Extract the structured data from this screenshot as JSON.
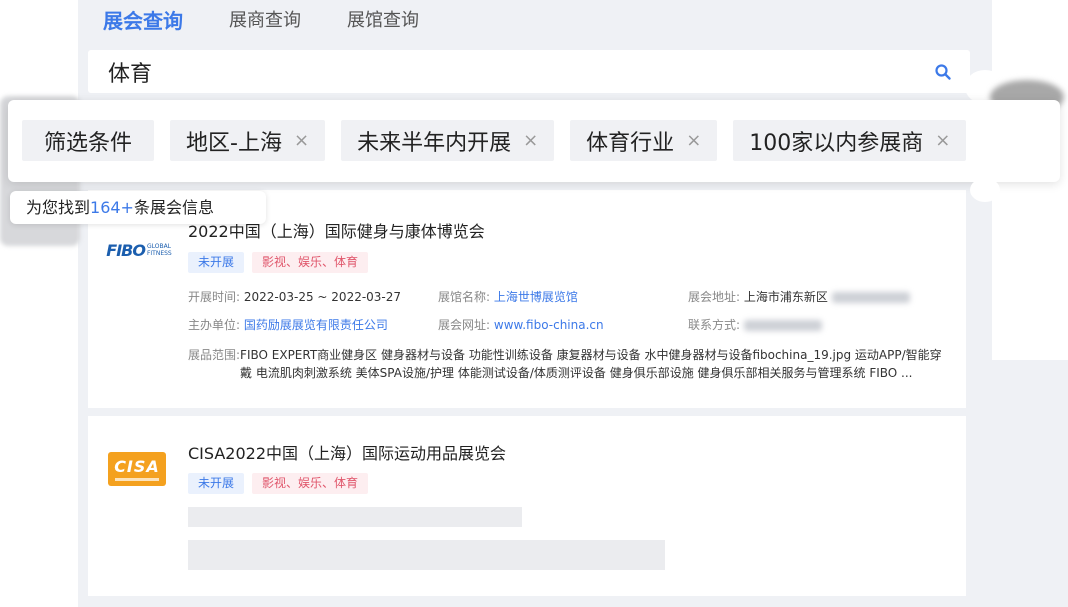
{
  "tabs": [
    {
      "label": "展会查询",
      "active": true
    },
    {
      "label": "展商查询",
      "active": false
    },
    {
      "label": "展馆查询",
      "active": false
    }
  ],
  "search": {
    "value": "体育",
    "icon": "search-icon"
  },
  "filters": {
    "label": "筛选条件",
    "chips": [
      "地区-上海",
      "未来半年内开展",
      "体育行业",
      "100家以内参展商"
    ],
    "remove_glyph": "×"
  },
  "result_count": {
    "prefix": "为您找到",
    "count": "164+",
    "suffix": "条展会信息"
  },
  "results": [
    {
      "logo_text": "FIBO",
      "logo_sub": "GLOBAL FITNESS",
      "title": "2022中国（上海）国际健身与康体博览会",
      "status": "未开展",
      "category": "影视、娱乐、体育",
      "fields": {
        "time_label": "开展时间:",
        "time_value": "2022-03-25 ~ 2022-03-27",
        "venue_label": "展馆名称:",
        "venue_value": "上海世博展览馆",
        "address_label": "展会地址:",
        "address_value": "上海市浦东新区",
        "organizer_label": "主办单位:",
        "organizer_value": "国药励展展览有限责任公司",
        "website_label": "展会网址:",
        "website_value": "www.fibo-china.cn",
        "contact_label": "联系方式:",
        "exhibits_label": "展品范围:",
        "exhibits_value": "FIBO EXPERT商业健身区 健身器材与设备 功能性训练设备 康复器材与设备 水中健身器材与设备fibochina_19.jpg 运动APP/智能穿戴 电流肌肉刺激系统 美体SPA设施/护理 体能测试设备/体质测评设备 健身俱乐部设施 健身俱乐部相关服务与管理系统 FIBO ..."
      }
    },
    {
      "logo_text": "CISA",
      "title": "CISA2022中国（上海）国际运动用品展览会",
      "status": "未开展",
      "category": "影视、娱乐、体育"
    }
  ],
  "colors": {
    "accent": "#3c79e8",
    "pink": "#e0566b",
    "cisa_orange": "#f4a11f",
    "fibo_blue": "#1b5eae"
  }
}
